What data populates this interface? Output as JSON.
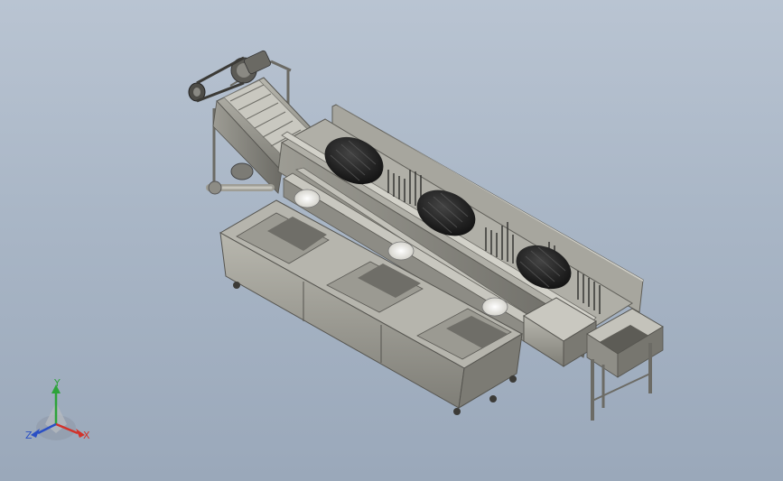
{
  "viewport": {
    "background_top": "#b9c4d2",
    "background_bottom": "#9aa8ba"
  },
  "model": {
    "body_color": "#8f8e87",
    "body_light": "#b3b2aa",
    "body_dark": "#5e5d57",
    "drum_color": "#1c1c1c"
  },
  "triad": {
    "x_label": "X",
    "y_label": "Y",
    "z_label": "Z",
    "x_color": "#d2322a",
    "y_color": "#2ea33a",
    "z_color": "#2a4fc4"
  }
}
